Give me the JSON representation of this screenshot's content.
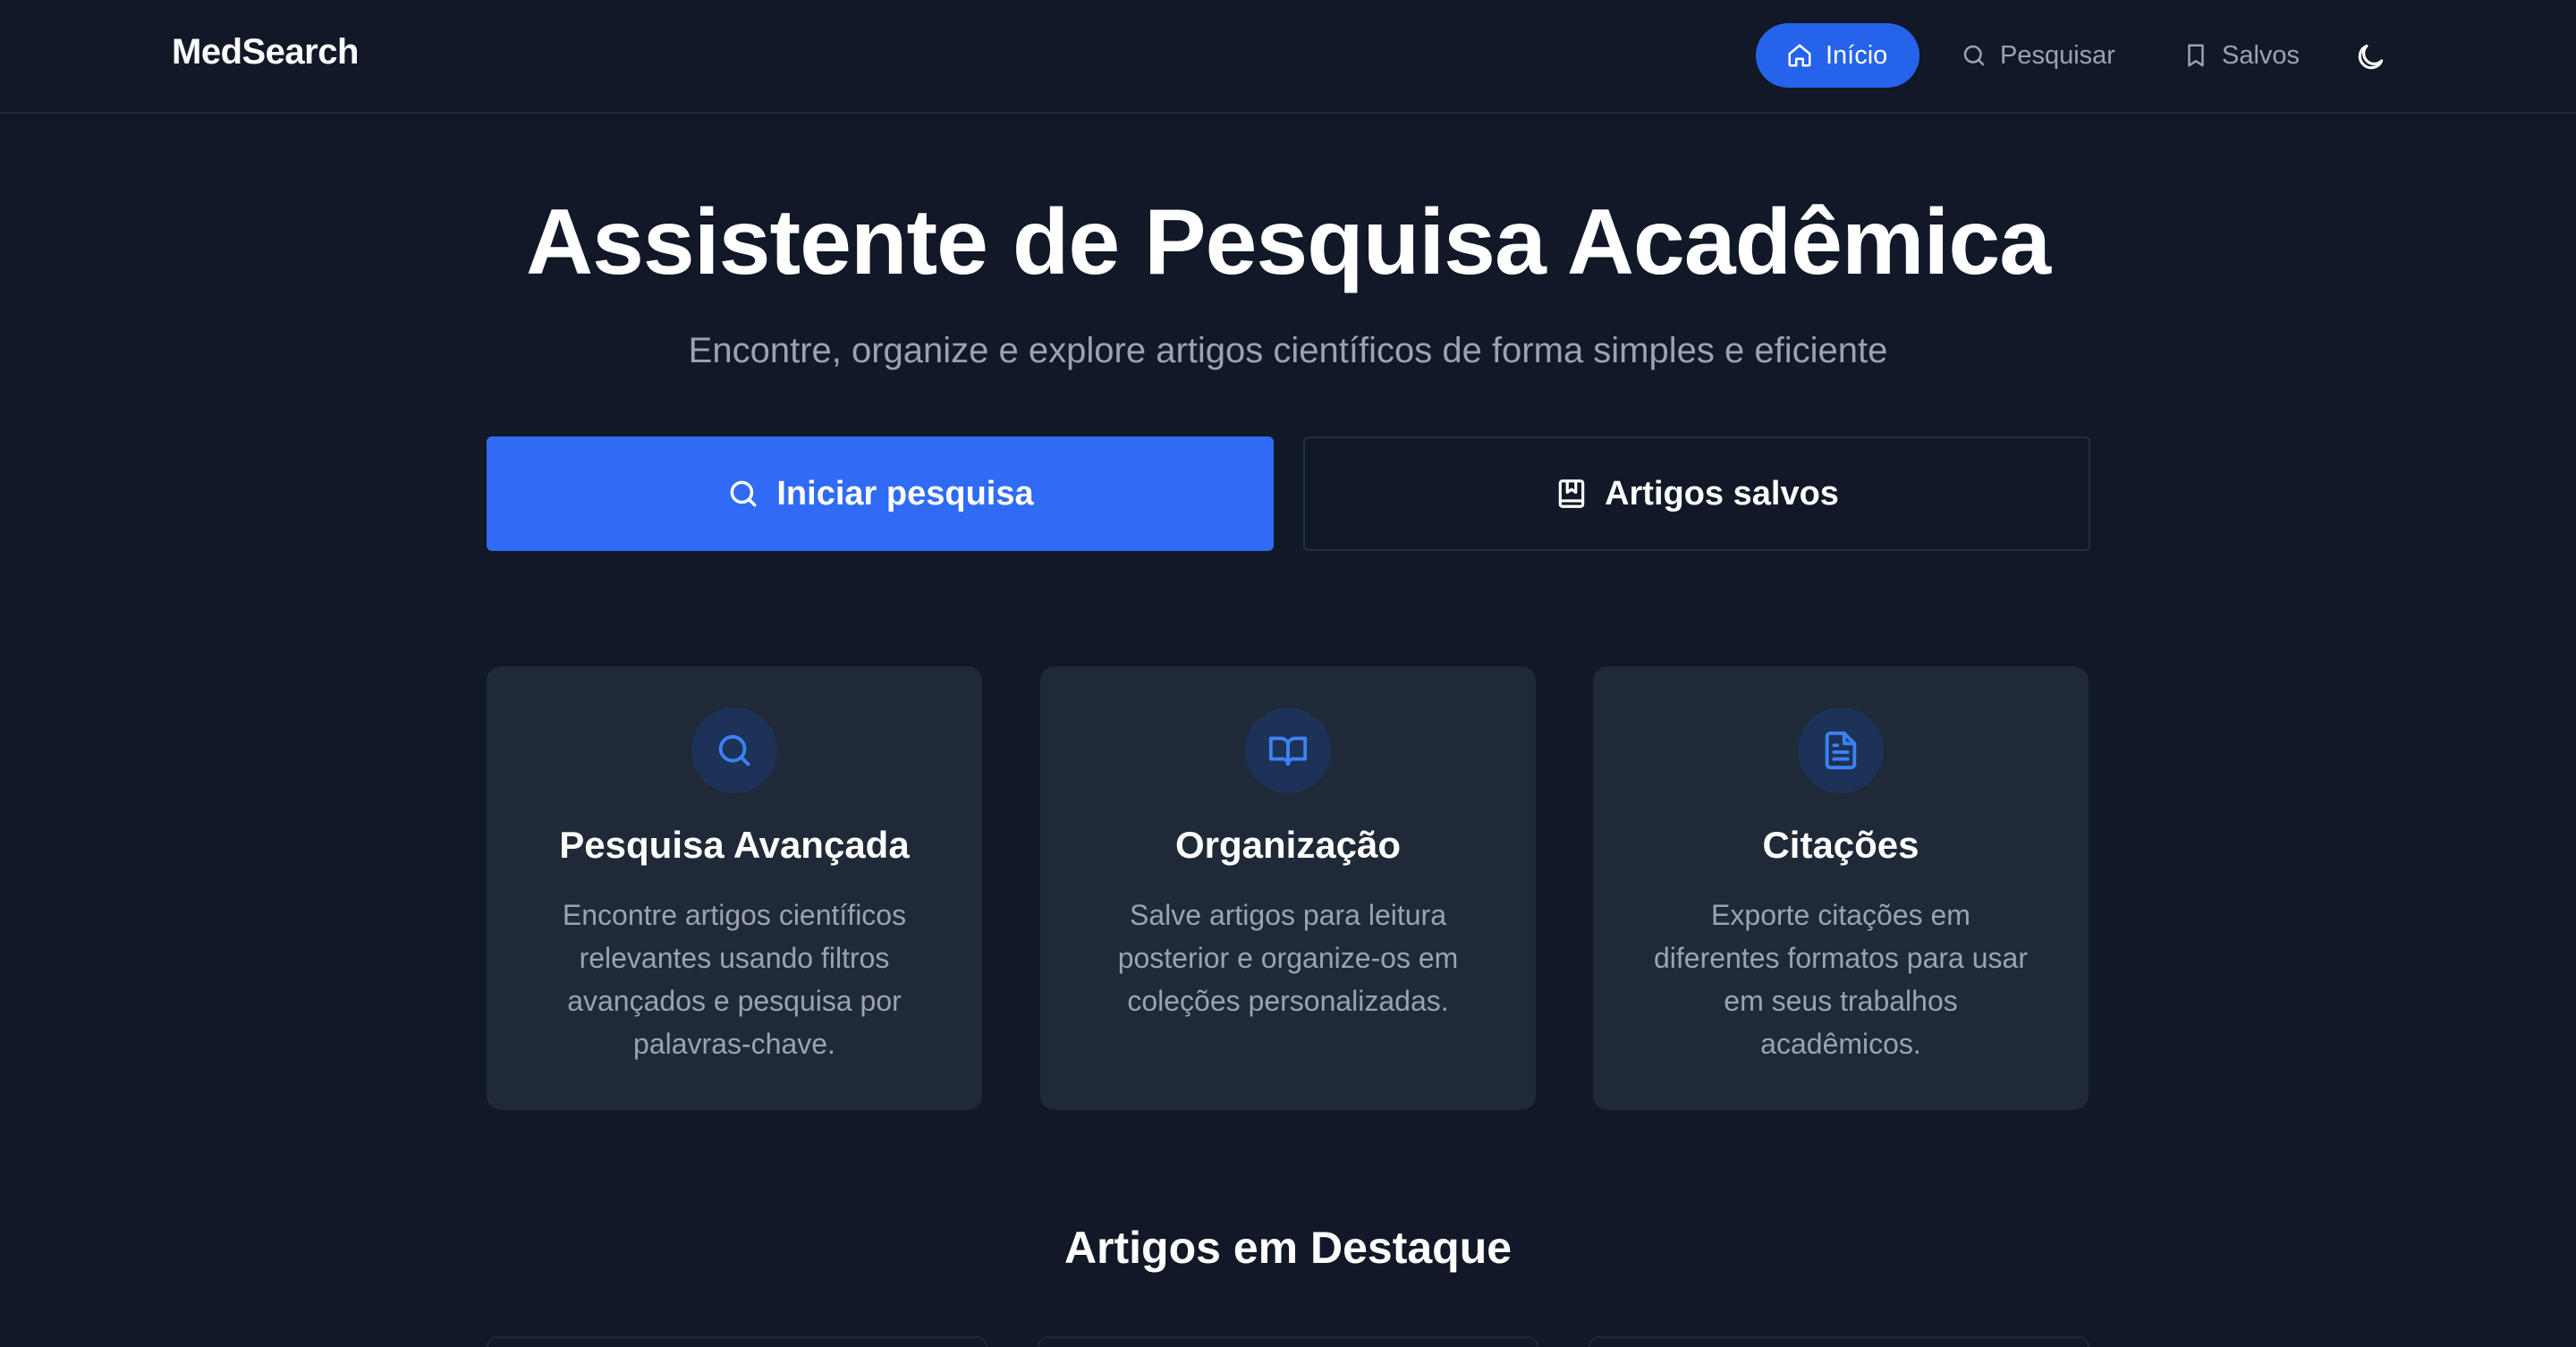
{
  "brand": "MedSearch",
  "nav": {
    "home": "Início",
    "search": "Pesquisar",
    "saved": "Salvos"
  },
  "icons": {
    "home": "home-icon",
    "search": "search-icon",
    "bookmark": "bookmark-icon",
    "theme": "moon-icon",
    "book": "book-open-icon",
    "document": "file-text-icon",
    "saved_book": "book-bookmark-icon"
  },
  "hero": {
    "title": "Assistente de Pesquisa Acadêmica",
    "subtitle": "Encontre, organize e explore artigos científicos de forma simples e eficiente",
    "primary_cta": "Iniciar pesquisa",
    "secondary_cta": "Artigos salvos"
  },
  "features": [
    {
      "title": "Pesquisa Avançada",
      "description": "Encontre artigos científicos relevantes usando filtros avançados e pesquisa por palavras-chave."
    },
    {
      "title": "Organização",
      "description": "Salve artigos para leitura posterior e organize-os em coleções personalizadas."
    },
    {
      "title": "Citações",
      "description": "Exporte citações em diferentes formatos para usar em seus trabalhos acadêmicos."
    }
  ],
  "featured": {
    "title": "Artigos em Destaque"
  },
  "colors": {
    "background": "#111827",
    "accent": "#2f6bf4",
    "card": "#1f2937",
    "muted_text": "#9ca3af"
  }
}
